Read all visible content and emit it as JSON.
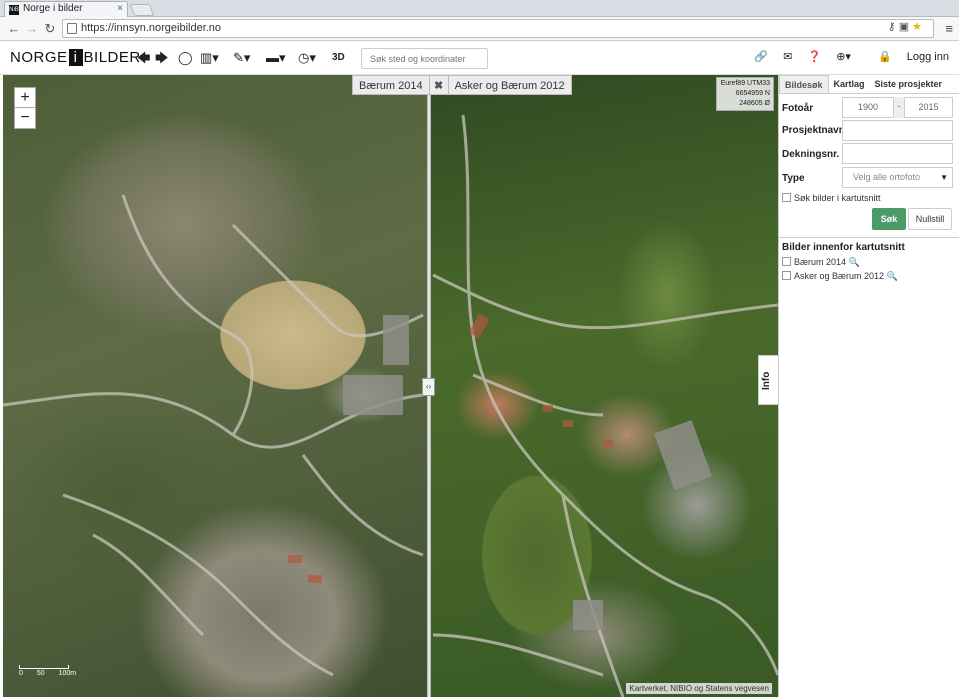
{
  "browser": {
    "tab_title": "Norge i bilder",
    "favicon_text": "NiB",
    "url": "https://innsyn.norgeibilder.no"
  },
  "app": {
    "logo_left": "NORGE",
    "logo_mid": "i",
    "logo_right": "BILDER",
    "search_placeholder": "Søk sted og koordinater",
    "mode_3d": "3D",
    "login_label": "Logg inn"
  },
  "map": {
    "layer_left": "Bærum 2014",
    "layer_close": "✖",
    "layer_right": "Asker og Bærum 2012",
    "coords": [
      "Euref89 UTM33",
      "6654959 N",
      "248605 Ø"
    ],
    "scale_labels": [
      "0",
      "50",
      "100m"
    ],
    "attribution": "Kartverket, NIBIO og Statens vegvesen",
    "zoom_in": "+",
    "zoom_out": "−",
    "info_tab": "Info"
  },
  "panel": {
    "tabs": [
      "Bildesøk",
      "Kartlag",
      "Siste prosjekter"
    ],
    "fotoar_label": "Fotoår",
    "year_from": "1900",
    "year_dash": "-",
    "year_to": "2015",
    "prosjektnavn_label": "Prosjektnavn",
    "dekningsnr_label": "Dekningsnr.",
    "type_label": "Type",
    "type_value": "Velg alle ortofoto",
    "search_in_view": "Søk bilder i kartutsnitt",
    "search_button": "Søk",
    "reset_button": "Nullstill",
    "results_title": "Bilder innenfor kartutsnitt",
    "results": [
      "Bærum 2014",
      "Asker og Bærum 2012"
    ]
  }
}
